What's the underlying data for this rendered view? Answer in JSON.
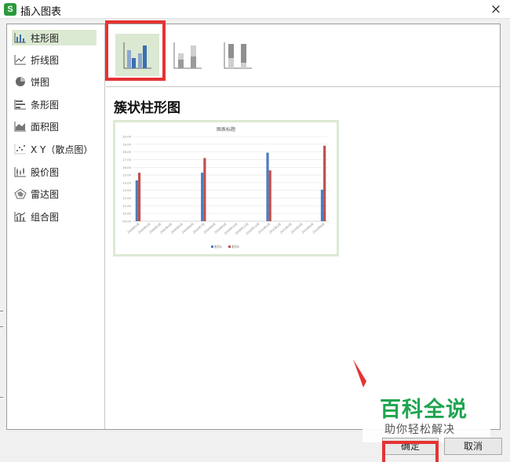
{
  "window": {
    "app_icon": "S",
    "title": "插入图表",
    "close_glyph": "×"
  },
  "sidebar": {
    "items": [
      {
        "label": "柱形图",
        "icon": "column-chart-icon",
        "selected": true
      },
      {
        "label": "折线图",
        "icon": "line-chart-icon"
      },
      {
        "label": "饼图",
        "icon": "pie-chart-icon"
      },
      {
        "label": "条形图",
        "icon": "bar-chart-icon"
      },
      {
        "label": "面积图",
        "icon": "area-chart-icon"
      },
      {
        "label": "X Y（散点图）",
        "icon": "scatter-chart-icon"
      },
      {
        "label": "股价图",
        "icon": "stock-chart-icon"
      },
      {
        "label": "雷达图",
        "icon": "radar-chart-icon"
      },
      {
        "label": "组合图",
        "icon": "combo-chart-icon"
      }
    ]
  },
  "subtypes": [
    {
      "icon": "clustered-column-icon",
      "selected": true
    },
    {
      "icon": "stacked-column-icon"
    },
    {
      "icon": "percent-stacked-column-icon"
    }
  ],
  "selected_chart_name": "簇状柱形图",
  "preview": {
    "chart_data": {
      "type": "bar",
      "title": "图表标题",
      "ylim": [
        9,
        20
      ],
      "yticks": [
        "09.00",
        "10.00",
        "11.00",
        "12.00",
        "13.00",
        "14.00",
        "15.00",
        "16.00",
        "17.00",
        "18.00",
        "19.00",
        "20.00"
      ],
      "categories": [
        "2009年1月",
        "2009年2月",
        "2009年3月",
        "2009年4月",
        "2009年5月",
        "2009年6月",
        "2009年7月",
        "2009年8月",
        "2009年9月",
        "2009年10月",
        "2009年11月",
        "2009年12月",
        "2010年1月",
        "2010年2月",
        "2010年3月",
        "2010年4月",
        "2010年5月",
        "2010年6月"
      ],
      "series": [
        {
          "name": "系列1",
          "color": "#4a7ebf",
          "values": [
            14.3,
            null,
            null,
            null,
            null,
            null,
            15.3,
            null,
            null,
            null,
            null,
            null,
            17.9,
            null,
            null,
            null,
            null,
            13.1
          ]
        },
        {
          "name": "系列2",
          "color": "#c0504d",
          "values": [
            15.3,
            null,
            null,
            null,
            null,
            null,
            17.2,
            null,
            null,
            null,
            null,
            null,
            15.6,
            null,
            null,
            null,
            null,
            18.8
          ]
        }
      ],
      "legend": "bottom",
      "grid": true
    }
  },
  "buttons": {
    "ok": "确定",
    "cancel": "取消"
  },
  "watermark": {
    "title": "百科全说",
    "subtitle": "助你轻松解决"
  },
  "colors": {
    "accent_green": "#1fa550",
    "selection_green": "#dce9d2",
    "highlight_red": "#e53333"
  }
}
